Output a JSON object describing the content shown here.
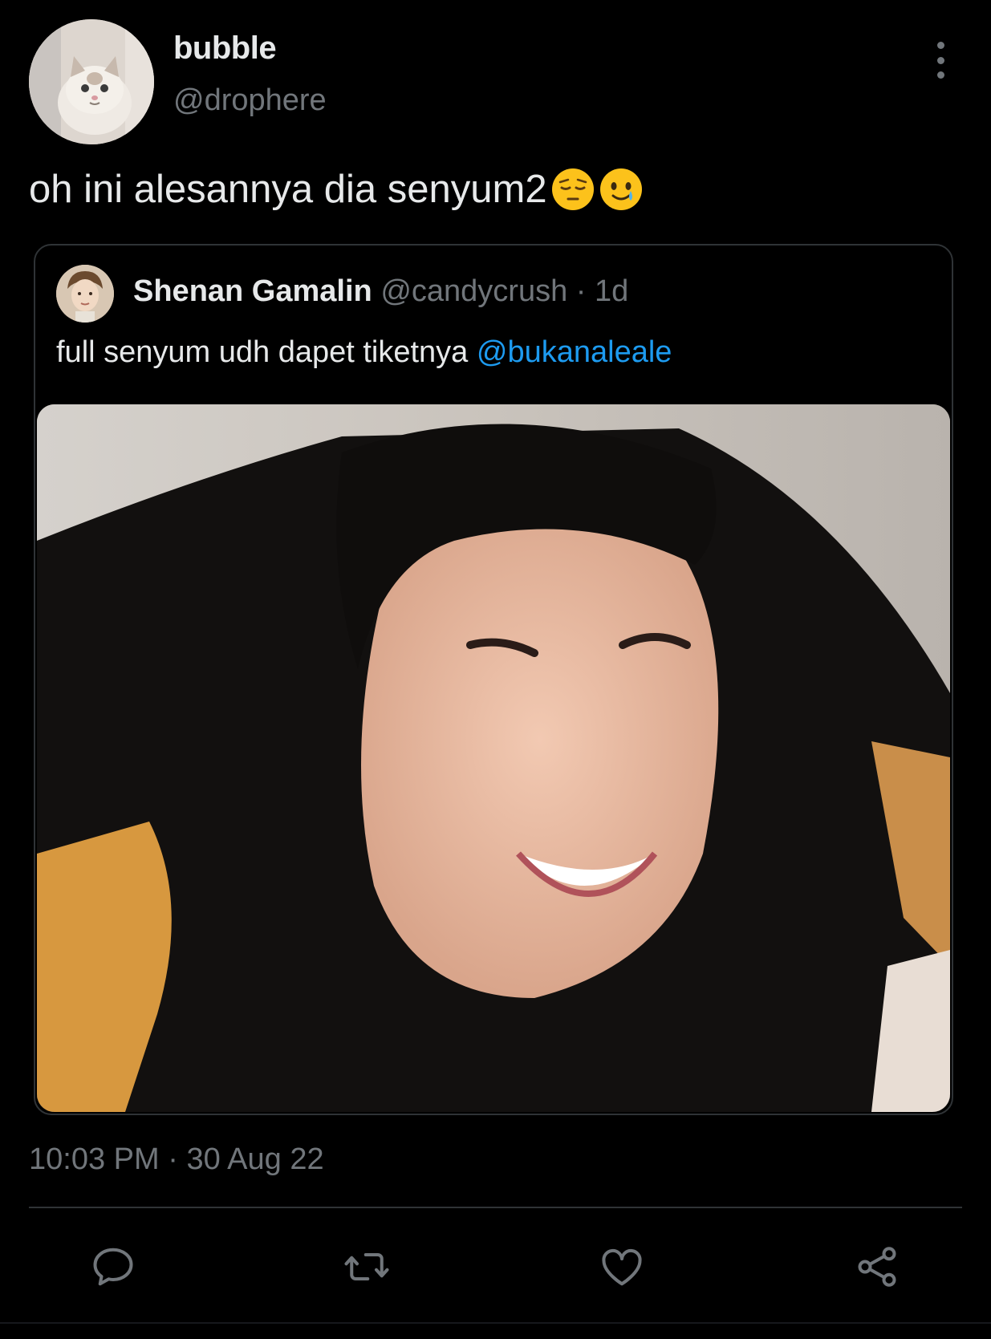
{
  "author": {
    "display_name": "bubble",
    "handle": "@drophere",
    "avatar_icon": "cat-avatar"
  },
  "tweet": {
    "text": "oh ini alesannya dia senyum2",
    "emojis": [
      "pensive-face-emoji",
      "smiling-face-with-tear-emoji"
    ]
  },
  "quoted_tweet": {
    "display_name": "Shenan Gamalin",
    "handle": "@candycrush",
    "separator": "·",
    "time": "1d",
    "text": "full senyum udh dapet tiketnya",
    "mention": "@bukanaleale",
    "media_icon": "smiling-person-photo"
  },
  "timestamp": {
    "time": "10:03 PM",
    "separator": "·",
    "date": "30 Aug 22"
  },
  "actions": [
    "reply-icon",
    "retweet-icon",
    "like-icon",
    "share-icon"
  ],
  "colors": {
    "background": "#000000",
    "text": "#e7e9ea",
    "muted": "#71767b",
    "accent": "#1d9bf0",
    "border": "#2f3336"
  }
}
